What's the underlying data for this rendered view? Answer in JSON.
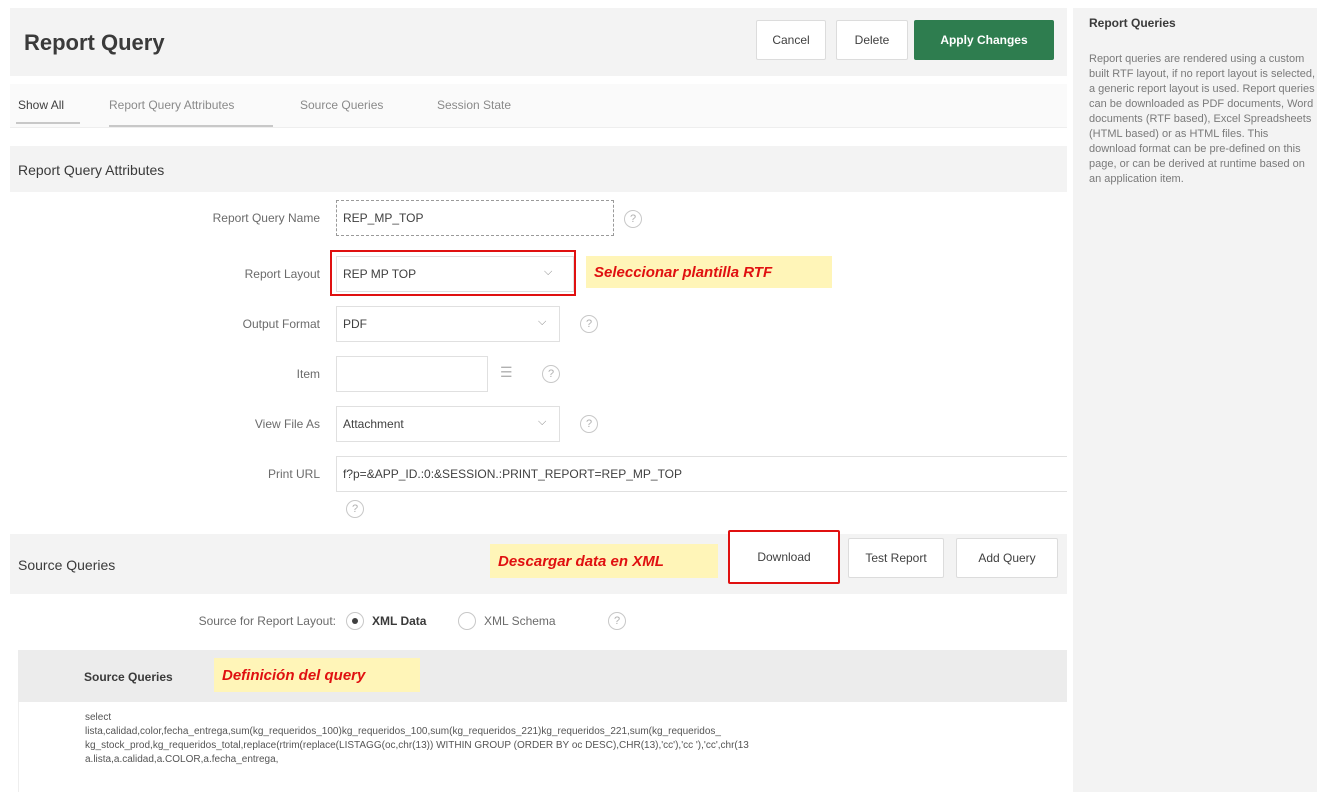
{
  "header": {
    "title": "Report Query",
    "cancel_label": "Cancel",
    "delete_label": "Delete",
    "apply_label": "Apply Changes"
  },
  "tabs": [
    {
      "label": "Show All"
    },
    {
      "label": "Report Query Attributes"
    },
    {
      "label": "Source Queries"
    },
    {
      "label": "Session State"
    }
  ],
  "attributes": {
    "section_title": "Report Query Attributes",
    "report_query_name": {
      "label": "Report Query Name",
      "value": "REP_MP_TOP"
    },
    "report_layout": {
      "label": "Report Layout",
      "value": "REP MP TOP"
    },
    "output_format": {
      "label": "Output Format",
      "value": "PDF"
    },
    "item": {
      "label": "Item",
      "value": ""
    },
    "view_file_as": {
      "label": "View File As",
      "value": "Attachment"
    },
    "print_url": {
      "label": "Print URL",
      "value": "f?p=&APP_ID.:0:&SESSION.:PRINT_REPORT=REP_MP_TOP"
    }
  },
  "annotations": {
    "layout": "Seleccionar plantilla RTF",
    "download": "Descargar data en XML",
    "query": "Definición del query"
  },
  "source_queries": {
    "section_title": "Source Queries",
    "download_label": "Download",
    "test_report_label": "Test Report",
    "add_query_label": "Add Query",
    "source_label": "Source for Report Layout:",
    "radio_xml_data": "XML Data",
    "radio_xml_schema": "XML Schema",
    "selected_source": "XML Data",
    "table_header": "Source Queries",
    "sql_lines": [
      "select",
      "lista,calidad,color,fecha_entrega,sum(kg_requeridos_100)kg_requeridos_100,sum(kg_requeridos_221)kg_requeridos_221,sum(kg_requeridos_",
      "kg_stock_prod,kg_requeridos_total,replace(rtrim(replace(LISTAGG(oc,chr(13)) WITHIN GROUP (ORDER BY oc DESC),CHR(13),'cc'),'cc '),'cc',chr(13",
      "a.lista,a.calidad,a.COLOR,a.fecha_entrega,"
    ]
  },
  "help": {
    "title": "Report Queries",
    "text": "Report queries are rendered using a custom built RTF layout, if no report layout is selected, a generic report layout is used. Report queries can be downloaded as PDF documents, Word documents (RTF based), Excel Spreadsheets (HTML based) or as HTML files. This download format can be pre-defined on this page, or can be derived at runtime based on an application item."
  },
  "icons": {
    "help": "help-icon",
    "chevron": "chevron-down-icon",
    "list": "list-icon"
  }
}
